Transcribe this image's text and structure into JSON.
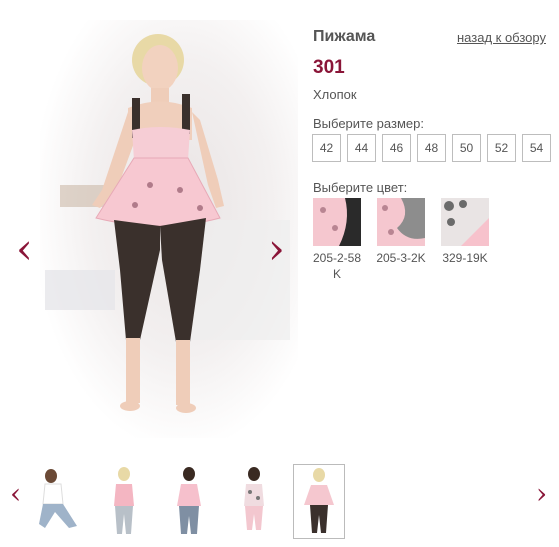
{
  "product": {
    "name": "Пижама",
    "price": "301",
    "material": "Хлопок",
    "back_link": "назад к обзору"
  },
  "sizes": {
    "label": "Выберите размер:",
    "options": [
      "42",
      "44",
      "46",
      "48",
      "50",
      "52",
      "54"
    ]
  },
  "colors": {
    "label": "Выберите цвет:",
    "options": [
      {
        "code": "205-2-58K",
        "swatch": "#f5c7cf",
        "accent": "#2a2a2a"
      },
      {
        "code": "205-3-2K",
        "swatch": "#f5c7cf",
        "accent": "#8d8d8d"
      },
      {
        "code": "329-19K",
        "swatch": "#f7c2cc",
        "accent": "#6b6b6b"
      }
    ]
  },
  "accent_color": "#8a1538",
  "gallery": {
    "thumbnails": [
      {
        "top": "#ffffff",
        "bottom": "#9fb3c9"
      },
      {
        "top": "#f4b6c2",
        "bottom": "#b8c0c8"
      },
      {
        "top": "#f6c0cc",
        "bottom": "#7f8fa3"
      },
      {
        "top": "#f0dce0",
        "bottom": "#f3c7cf"
      },
      {
        "top": "#f5c7cf",
        "bottom": "#3a302c"
      }
    ],
    "active_index": 4
  }
}
